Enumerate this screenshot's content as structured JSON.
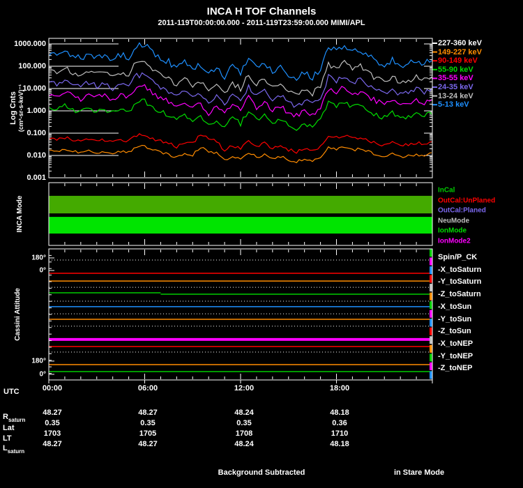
{
  "header": {
    "title": "INCA H TOF Channels",
    "subtitle": "2011-119T00:00:00.000 - 2011-119T23:59:00.000 MIMI/APL"
  },
  "footer": {
    "left": "Background Subtracted",
    "right": "in Stare Mode"
  },
  "axis_titles": {
    "top_line1": "Log Cnts",
    "top_line2": "(cm²-sr-s-keV)⁻¹",
    "middle": "INCA Mode",
    "bottom": "Cassini Attitude",
    "utc": "UTC"
  },
  "chart_data": [
    {
      "type": "line",
      "panel": "tof-spectra",
      "yscale": "log",
      "ylim": [
        0.001,
        1000
      ],
      "ytick_labels": [
        "1000.000",
        "100.000",
        "10.000",
        "1.000",
        "0.100",
        "0.010",
        "0.001"
      ],
      "xlim_hours": [
        0,
        24
      ],
      "x_step_hours": 0.5,
      "legend": [
        {
          "label": "227-360 keV",
          "color": "#FFFFFF"
        },
        {
          "label": "149-227 keV",
          "color": "#FF8C00"
        },
        {
          "label": "90-149 keV",
          "color": "#FF0000"
        },
        {
          "label": "55-90 keV",
          "color": "#00DD00"
        },
        {
          "label": "35-55 keV",
          "color": "#FF00FF"
        },
        {
          "label": "24-35 keV",
          "color": "#7B68EE"
        },
        {
          "label": "13-24 keV",
          "color": "#BEBEBE"
        },
        {
          "label": "5-13 keV",
          "color": "#1E90FF"
        }
      ],
      "series": [
        {
          "name": "5-13 keV",
          "color": "#1E90FF",
          "jag": 0.14,
          "log10_values": [
            2.6,
            2.5,
            2.7,
            2.5,
            2.35,
            2.6,
            2.4,
            2.5,
            2.3,
            2.5,
            2.4,
            2.95,
            3.0,
            2.6,
            2.4,
            2.2,
            1.9,
            2.2,
            1.8,
            2.1,
            1.6,
            1.9,
            1.55,
            2.0,
            1.7,
            2.4,
            1.9,
            2.2,
            1.75,
            2.0,
            1.6,
            1.45,
            1.7,
            1.5,
            1.9,
            2.85,
            2.7,
            2.95,
            2.6,
            2.75,
            2.45,
            2.2,
            2.05,
            2.3,
            1.95,
            2.1,
            2.25,
            2.15,
            2.3
          ]
        },
        {
          "name": "13-24 keV",
          "color": "#BEBEBE",
          "jag": 0.13,
          "log10_values": [
            1.84,
            1.74,
            1.93,
            1.74,
            1.6,
            1.84,
            1.65,
            1.74,
            1.55,
            1.74,
            1.65,
            2.17,
            2.22,
            1.84,
            1.65,
            1.46,
            1.17,
            1.46,
            1.08,
            1.36,
            0.89,
            1.17,
            0.84,
            1.27,
            0.98,
            1.65,
            1.17,
            1.46,
            1.03,
            1.27,
            0.89,
            0.74,
            0.98,
            0.79,
            1.17,
            2.07,
            1.93,
            2.17,
            1.84,
            1.98,
            1.69,
            1.46,
            1.31,
            1.55,
            1.22,
            1.36,
            1.5,
            1.41,
            1.55
          ]
        },
        {
          "name": "24-35 keV",
          "color": "#7B68EE",
          "jag": 0.13,
          "log10_values": [
            1.27,
            1.18,
            1.36,
            1.18,
            1.05,
            1.27,
            1.09,
            1.18,
            1.0,
            1.18,
            1.09,
            1.59,
            1.63,
            1.27,
            1.09,
            0.91,
            0.64,
            0.91,
            0.55,
            0.82,
            0.37,
            0.64,
            0.33,
            0.73,
            0.46,
            1.09,
            0.64,
            0.91,
            0.51,
            0.73,
            0.37,
            0.24,
            0.46,
            0.28,
            0.64,
            1.5,
            1.36,
            1.59,
            1.27,
            1.41,
            1.14,
            0.91,
            0.78,
            1.0,
            0.69,
            0.82,
            0.96,
            0.87,
            1.0
          ]
        },
        {
          "name": "35-55 keV",
          "color": "#FF00FF",
          "jag": 0.12,
          "log10_values": [
            0.76,
            0.67,
            0.84,
            0.67,
            0.54,
            0.76,
            0.59,
            0.67,
            0.5,
            0.67,
            0.59,
            1.05,
            1.1,
            0.76,
            0.59,
            0.42,
            0.16,
            0.42,
            0.08,
            0.33,
            -0.1,
            0.16,
            -0.14,
            0.25,
            -0.01,
            0.59,
            0.16,
            0.42,
            0.03,
            0.25,
            -0.1,
            -0.22,
            -0.01,
            -0.18,
            0.16,
            0.97,
            0.84,
            1.05,
            0.76,
            0.88,
            0.63,
            0.42,
            0.29,
            0.5,
            0.2,
            0.33,
            0.46,
            0.37,
            0.5
          ]
        },
        {
          "name": "55-90 keV",
          "color": "#00DD00",
          "jag": 0.11,
          "log10_values": [
            0.14,
            0.06,
            0.22,
            0.06,
            -0.06,
            0.14,
            -0.02,
            0.06,
            -0.1,
            0.06,
            -0.02,
            0.42,
            0.46,
            0.14,
            -0.02,
            -0.18,
            -0.42,
            -0.18,
            -0.5,
            -0.26,
            -0.66,
            -0.42,
            -0.7,
            -0.34,
            -0.58,
            -0.02,
            -0.42,
            -0.18,
            -0.54,
            -0.34,
            -0.66,
            -0.78,
            -0.58,
            -0.74,
            -0.42,
            0.34,
            0.22,
            0.42,
            0.14,
            0.26,
            0.02,
            -0.18,
            -0.3,
            -0.1,
            -0.38,
            -0.26,
            -0.14,
            -0.22,
            -0.1
          ]
        },
        {
          "name": "90-149 keV",
          "color": "#FF0000",
          "jag": 0.07,
          "log10_values": [
            -1.25,
            -1.3,
            -1.2,
            -1.3,
            -1.38,
            -1.25,
            -1.35,
            -1.3,
            -1.4,
            -1.3,
            -1.35,
            -1.08,
            -1.05,
            -1.25,
            -1.35,
            -1.45,
            -1.6,
            -1.45,
            -1.45,
            -1.05,
            -1.25,
            -1.35,
            -1.78,
            -1.55,
            -1.7,
            -1.35,
            -1.6,
            -1.45,
            -1.68,
            -1.55,
            -1.75,
            -1.83,
            -1.7,
            -1.8,
            -1.6,
            -1.13,
            -1.2,
            -1.08,
            -1.25,
            -1.18,
            -1.33,
            -1.45,
            -1.53,
            -1.4,
            -1.58,
            -1.5,
            -1.43,
            -1.48,
            -1.4
          ]
        },
        {
          "name": "149-227 keV",
          "color": "#FF8C00",
          "jag": 0.06,
          "log10_values": [
            -1.77,
            -1.81,
            -1.72,
            -1.81,
            -1.88,
            -1.77,
            -1.86,
            -1.81,
            -1.9,
            -1.81,
            -1.86,
            -1.61,
            -1.59,
            -1.77,
            -1.86,
            -1.95,
            -2.08,
            -1.95,
            -1.98,
            -1.64,
            -1.82,
            -1.88,
            -2.24,
            -2.04,
            -2.17,
            -1.86,
            -2.08,
            -1.95,
            -2.15,
            -2.04,
            -2.22,
            -2.28,
            -2.17,
            -2.26,
            -2.08,
            -1.65,
            -1.72,
            -1.61,
            -1.77,
            -1.7,
            -1.83,
            -1.95,
            -2.01,
            -1.9,
            -2.07,
            -2.01,
            -1.96,
            -1.99,
            -1.9
          ]
        }
      ]
    },
    {
      "type": "mode-bars",
      "panel": "inca-mode",
      "legend": [
        {
          "label": "InCal",
          "color": "#00CC00"
        },
        {
          "label": "OutCal:UnPlaned",
          "color": "#FF0000"
        },
        {
          "label": "OutCal:Planed",
          "color": "#7B68EE"
        },
        {
          "label": "NeuMode",
          "color": "#BEBEBE"
        },
        {
          "label": "IonMode",
          "color": "#00DD00"
        },
        {
          "label": "IonMode2",
          "color": "#FF00FF"
        }
      ],
      "bars": [
        {
          "color": "#44AA00",
          "top_frac": 0.21,
          "h_frac": 0.28,
          "x0_h": 0,
          "x1_h": 24
        },
        {
          "color": "#00E400",
          "top_frac": 0.545,
          "h_frac": 0.265,
          "x0_h": 0,
          "x1_h": 24
        }
      ]
    },
    {
      "type": "attitude-lines",
      "panel": "cassini-attitude",
      "legend": [
        {
          "label": "Spin/P_CK",
          "color": "#FFFFFF"
        },
        {
          "label": "-X_toSaturn",
          "color": "#FFFFFF"
        },
        {
          "label": "-Y_toSaturn",
          "color": "#FFFFFF"
        },
        {
          "label": "-Z_toSaturn",
          "color": "#FFFFFF"
        },
        {
          "label": "-X_toSun",
          "color": "#FFFFFF"
        },
        {
          "label": "-Y_toSun",
          "color": "#FFFFFF"
        },
        {
          "label": "-Z_toSun",
          "color": "#FFFFFF"
        },
        {
          "label": "-X_toNEP",
          "color": "#FFFFFF"
        },
        {
          "label": "-Y_toNEP",
          "color": "#FFFFFF"
        },
        {
          "label": "-Z_toNEP",
          "color": "#FFFFFF"
        }
      ],
      "ytick_labels": [
        {
          "label": "180°",
          "y_frac": 0.069
        },
        {
          "label": "0°",
          "y_frac": 0.165
        },
        {
          "label": "180°",
          "y_frac": 0.856
        },
        {
          "label": "0°",
          "y_frac": 0.957
        }
      ],
      "lines": [
        {
          "color": "#FFFFFF",
          "style": "dotted",
          "w": 1,
          "y_frac": 0.085
        },
        {
          "color": "#FF0000",
          "style": "solid",
          "w": 1.5,
          "y_frac": 0.186
        },
        {
          "color": "#FF8C00",
          "style": "solid",
          "w": 1.5,
          "y_frac": 0.245
        },
        {
          "color": "#FFFFFF",
          "style": "dotted",
          "w": 1,
          "y_frac": 0.293
        },
        {
          "color": "#00CC00",
          "style": "solid",
          "w": 1.5,
          "y_frac": 0.335,
          "x1_h": 7
        },
        {
          "color": "#00CC00",
          "style": "solid",
          "w": 1.5,
          "y_frac": 0.346,
          "x0_h": 7
        },
        {
          "color": "#FFFFFF",
          "style": "dotted",
          "w": 1,
          "y_frac": 0.399
        },
        {
          "color": "#1E90FF",
          "style": "solid",
          "w": 1.5,
          "y_frac": 0.441
        },
        {
          "color": "#FFFFFF",
          "style": "dotted",
          "w": 1,
          "y_frac": 0.495
        },
        {
          "color": "#FF8C00",
          "style": "solid",
          "w": 1.5,
          "y_frac": 0.537
        },
        {
          "color": "#FFFFFF",
          "style": "dotted",
          "w": 1,
          "y_frac": 0.59
        },
        {
          "color": "#FF00FF",
          "style": "solid",
          "w": 4,
          "y_frac": 0.691
        },
        {
          "color": "#FF0000",
          "style": "solid",
          "w": 1.5,
          "y_frac": 0.745
        },
        {
          "color": "#FFFFFF",
          "style": "dotted",
          "w": 1,
          "y_frac": 0.787
        },
        {
          "color": "#FF8C00",
          "style": "solid",
          "w": 1.5,
          "y_frac": 0.883
        },
        {
          "color": "#00CC00",
          "style": "solid",
          "w": 1.5,
          "y_frac": 0.936
        }
      ],
      "right_strip_cycle": [
        "#00CC00",
        "#FF00FF",
        "#1E90FF",
        "#FF0000",
        "#BEBEBE",
        "#FF8C00"
      ],
      "right_strip_segments": 15
    }
  ],
  "xaxis": {
    "utc_labels": [
      "00:00",
      "06:00",
      "12:00",
      "18:00"
    ],
    "tick_hours": [
      0,
      6,
      12,
      18
    ]
  },
  "table": {
    "rows": [
      {
        "label": "R",
        "sub": "saturn",
        "values": [
          "48.27",
          "48.27",
          "48.24",
          "48.18"
        ]
      },
      {
        "label": "Lat",
        "sub": "",
        "values": [
          "0.35",
          "0.35",
          "0.35",
          "0.36"
        ]
      },
      {
        "label": "LT",
        "sub": "",
        "values": [
          "1703",
          "1705",
          "1708",
          "1710"
        ]
      },
      {
        "label": "L",
        "sub": "saturn",
        "values": [
          "48.27",
          "48.27",
          "48.24",
          "48.18"
        ]
      }
    ]
  }
}
